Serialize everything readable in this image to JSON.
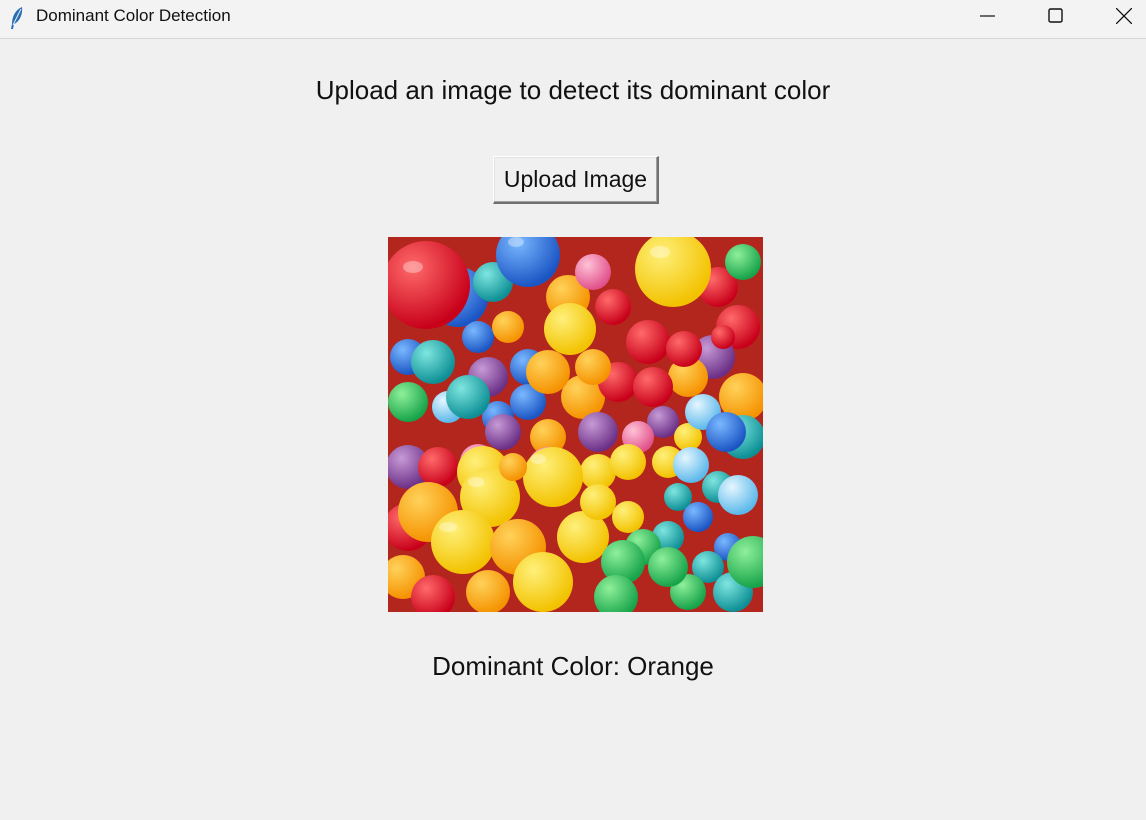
{
  "window": {
    "title": "Dominant Color Detection",
    "icon": "feather-icon"
  },
  "main": {
    "heading": "Upload an image to detect its dominant color",
    "upload_button_label": "Upload Image",
    "result_text": "Dominant Color: Orange"
  },
  "colors": {
    "background": "#f0f0f0",
    "text": "#111111"
  }
}
